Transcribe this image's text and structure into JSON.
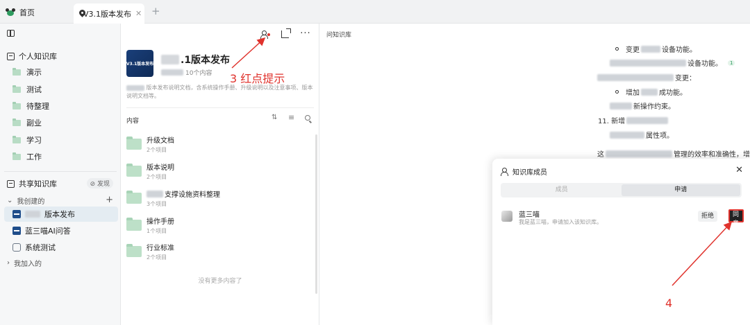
{
  "tabs": {
    "home_label": "首页",
    "active_label": "V3.1版本发布",
    "close_glyph": "✕",
    "add_glyph": "+"
  },
  "sidebar": {
    "personal_label": "个人知识库",
    "folders": [
      "演示",
      "测试",
      "待整理",
      "副业",
      "学习",
      "工作"
    ],
    "shared_label": "共享知识库",
    "discover_label": "⊘ 发现",
    "my_created_label": "我创建的",
    "add_glyph": "+",
    "kbs": [
      {
        "label": "版本发布",
        "active": true
      },
      {
        "label": "蓝三喵AI问答",
        "active": false
      },
      {
        "label": "系统测试",
        "active": false
      }
    ],
    "joined_label": "我加入的"
  },
  "middle": {
    "cover_text": "V3.1版本发布",
    "title_suffix": ".1版本发布",
    "meta_suffix": "10个内容",
    "desc_text": "版本发布说明文档，含系统操作手册、升级说明以及注意事项、版本说明文档等。",
    "content_label": "内容",
    "items": [
      {
        "name": "升级文档",
        "sub": "2个项目"
      },
      {
        "name": "版本说明",
        "sub": "2个项目"
      },
      {
        "name": "支撑设施资料整理",
        "sub": "3个项目"
      },
      {
        "name": "操作手册",
        "sub": "1个项目"
      },
      {
        "name": "行业标准",
        "sub": "2个项目"
      }
    ],
    "no_more": "没有更多内容了"
  },
  "right": {
    "doc_title": "问知识库",
    "lines": [
      {
        "type": "bullet",
        "pre": "变更",
        "post": "设备功能。"
      },
      {
        "type": "plain",
        "pre": "",
        "post": "设备功能。",
        "badge": "1"
      },
      {
        "type": "plain",
        "pre": "",
        "post": "变更："
      },
      {
        "type": "bullet",
        "pre": "增加",
        "post": "成功能。"
      },
      {
        "type": "plain",
        "pre": "",
        "post": "新操作约束。"
      },
      {
        "type": "plain",
        "pre": "11. 新增",
        "post": ""
      },
      {
        "type": "plain",
        "pre": "",
        "post": "属性项。"
      },
      {
        "type": "plain",
        "pre": "这",
        "post": "管理的效率和准确性，增强"
      }
    ]
  },
  "dialog": {
    "title": "知识库成员",
    "close_glyph": "✕",
    "seg_members": "成员",
    "seg_apply": "申请",
    "applicant_name": "蓝三喵",
    "applicant_msg": "我是蓝三喵，申请加入该知识库。",
    "reject_label": "拒绝",
    "agree_label": "同意"
  },
  "annotations": {
    "note3": "3  红点提示",
    "note4": "4",
    "color": "#e0322c"
  }
}
